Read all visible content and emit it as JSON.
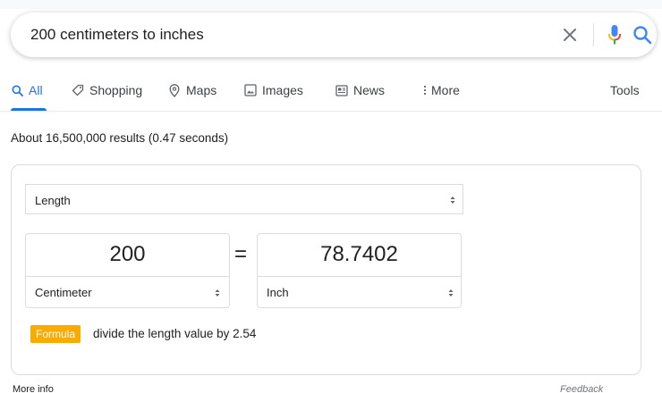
{
  "search": {
    "query": "200 centimeters to inches"
  },
  "icons": {
    "clear": "close-icon",
    "mic": "microphone-icon",
    "search": "search-icon"
  },
  "tabs": [
    {
      "label": "All",
      "icon": "search-icon",
      "active": true
    },
    {
      "label": "Shopping",
      "icon": "tag-icon",
      "active": false
    },
    {
      "label": "Maps",
      "icon": "map-pin-icon",
      "active": false
    },
    {
      "label": "Images",
      "icon": "image-icon",
      "active": false
    },
    {
      "label": "News",
      "icon": "newspaper-icon",
      "active": false
    },
    {
      "label": "More",
      "icon": "more-vert-icon",
      "active": false
    }
  ],
  "tools_label": "Tools",
  "result_stats": "About 16,500,000 results (0.47 seconds)",
  "converter": {
    "category": "Length",
    "from": {
      "value": "200",
      "unit": "Centimeter"
    },
    "equals": "=",
    "to": {
      "value": "78.7402",
      "unit": "Inch"
    },
    "formula_label": "Formula",
    "formula_text": "divide the length value by 2.54"
  },
  "footer": {
    "more_info": "More info",
    "feedback": "Feedback"
  },
  "colors": {
    "accent": "#1a73e8",
    "formula_badge": "#f9ab00",
    "mic_blue": "#4285f4",
    "mic_red": "#ea4335",
    "mic_yellow": "#fbbc04",
    "mic_green": "#34a853"
  }
}
